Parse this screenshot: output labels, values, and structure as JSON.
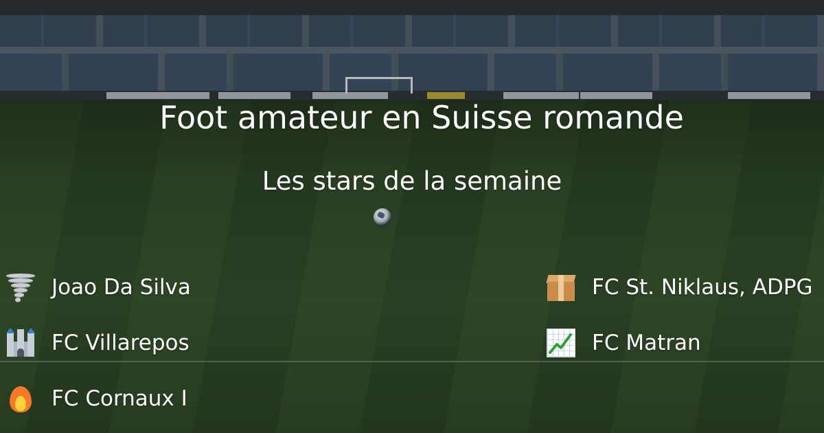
{
  "page": {
    "title": "Foot amateur en Suisse romande",
    "subtitle": "Les stars de la semaine"
  },
  "stars": {
    "left": [
      {
        "label": "Joao Da Silva",
        "icon": "tornado-icon"
      },
      {
        "label": "FC Villarepos",
        "icon": "castle-icon"
      },
      {
        "label": "FC Cornaux I",
        "icon": "fire-icon"
      }
    ],
    "right": [
      {
        "label": "FC St. Niklaus, ADPG",
        "icon": "package-icon"
      },
      {
        "label": "FC Matran",
        "icon": "chart-increasing-icon"
      }
    ]
  },
  "colors": {
    "text": "#ffffff",
    "pitch": "#3c5a2e",
    "chart_line": "#2e9e3e"
  }
}
